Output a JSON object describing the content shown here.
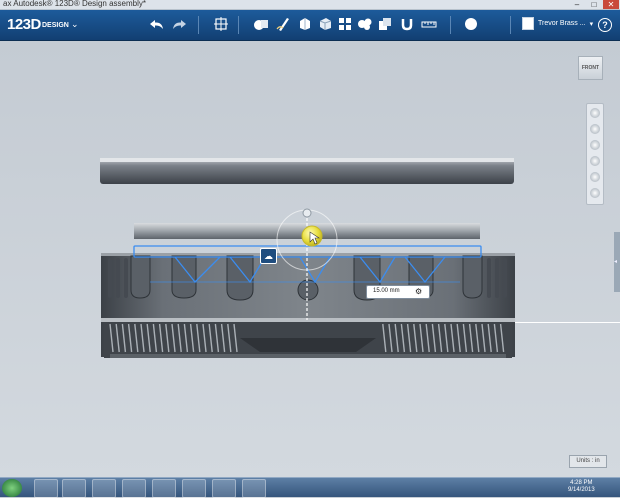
{
  "window": {
    "title": "ax Autodesk® 123D® Design assembly*",
    "min": "–",
    "max": "□",
    "close": "✕"
  },
  "app": {
    "logo": "123D",
    "logo_sub": "DESIGN",
    "user_name": "Trevor Brass ...",
    "help": "?"
  },
  "toolbar_icons": [
    "undo-icon",
    "redo-icon",
    "transform-icon",
    "primitives-icon",
    "sketch-icon",
    "construct-icon",
    "modify-icon",
    "pattern-icon",
    "grouping-icon",
    "combine-icon",
    "snap-icon",
    "measure-icon",
    "material-icon"
  ],
  "viewcube_label": "FRONT",
  "dimension": {
    "value": "15.00 mm"
  },
  "units_label": "Units : in",
  "clock": {
    "time": "4:28 PM",
    "date": "9/14/2013"
  },
  "colors": {
    "appbar": "#1a5290",
    "selection": "#2e7ee0",
    "accent": "#f1e84b"
  }
}
